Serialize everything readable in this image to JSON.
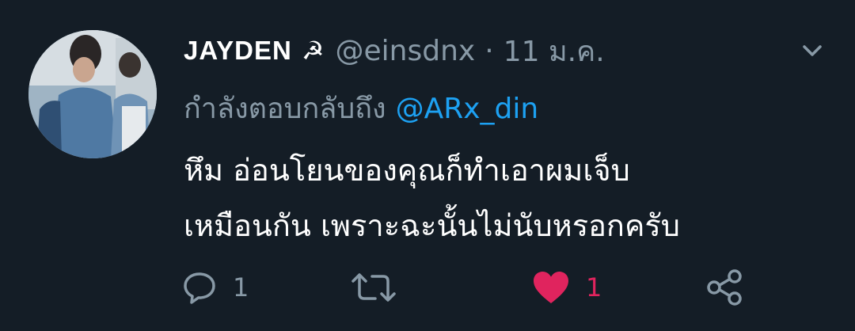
{
  "tweet": {
    "display_name": "JAYDEN",
    "name_emoji": "☭",
    "handle": "@einsdnx",
    "separator": "·",
    "timestamp": "11 ม.ค.",
    "reply_prefix": "กำลังตอบกลับถึง",
    "reply_to": "@ARx_din",
    "text_lines": [
      "หึม อ่อนโยนของคุณก็ทำเอาผมเจ็บ",
      "เหมือนกัน เพราะฉะนั้นไม่นับหรอกครับ"
    ]
  },
  "actions": {
    "reply": {
      "icon": "speech-bubble-icon",
      "count": "1"
    },
    "retweet": {
      "icon": "retweet-icon"
    },
    "like": {
      "icon": "heart-icon",
      "count": "1",
      "liked": true
    },
    "share": {
      "icon": "share-icon"
    }
  },
  "colors": {
    "background": "#141d26",
    "primary_text": "#ffffff",
    "secondary_text": "#8899a6",
    "mention": "#1da1f2",
    "like": "#e0245e"
  }
}
